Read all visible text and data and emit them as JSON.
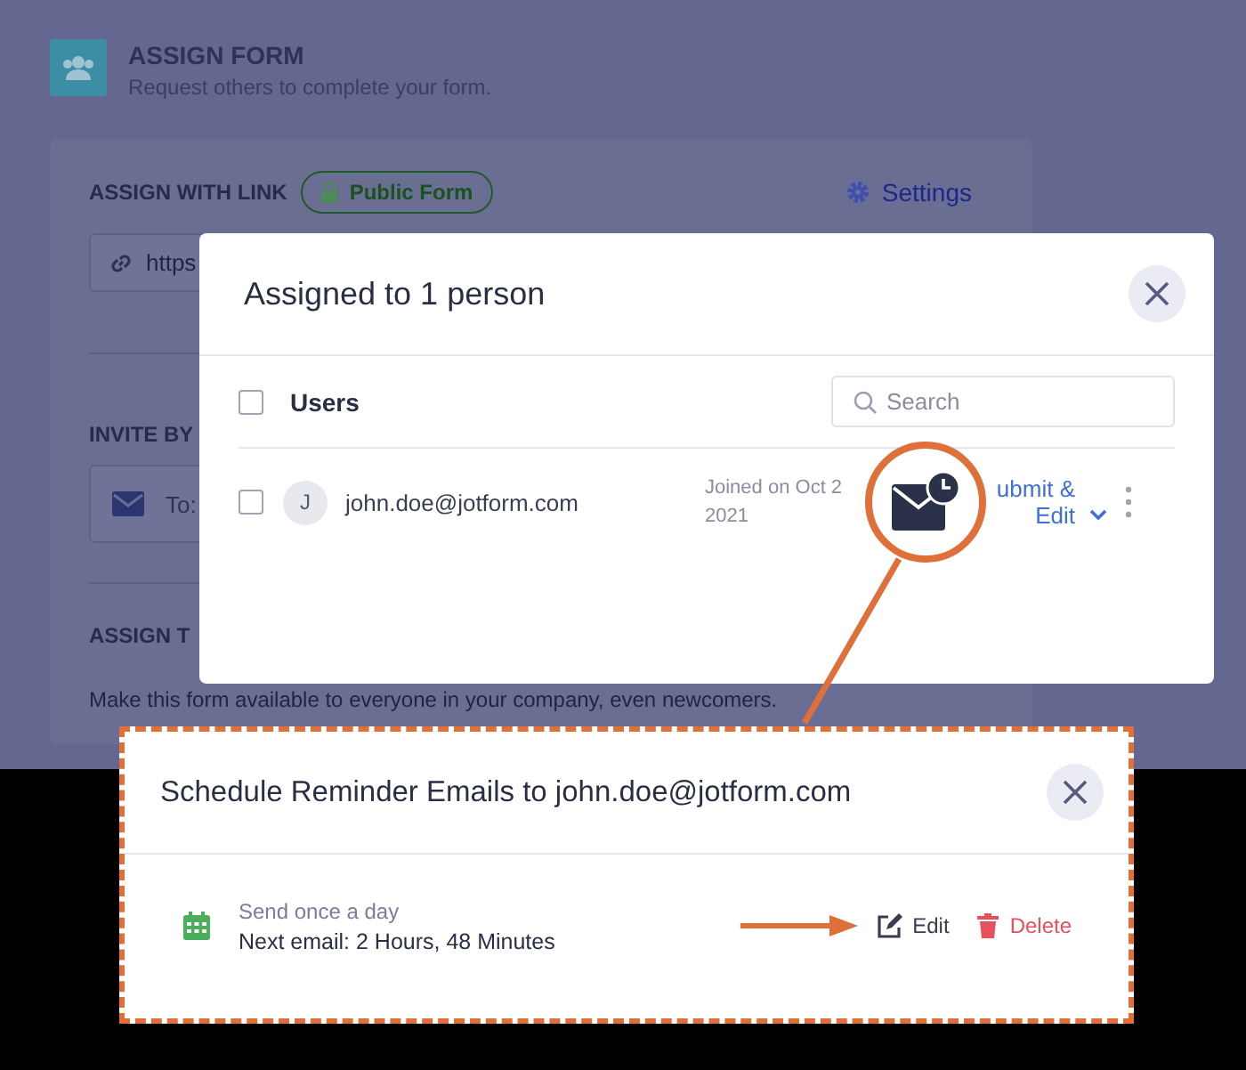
{
  "page": {
    "title": "ASSIGN FORM",
    "subtitle": "Request others to complete your form.",
    "link_section": {
      "heading": "ASSIGN WITH LINK",
      "badge": "Public Form",
      "settings": "Settings",
      "link_value": "https"
    },
    "invite_section": {
      "heading": "INVITE BY",
      "to_label": "To:"
    },
    "company_section": {
      "heading": "ASSIGN T",
      "description": "Make this form available to everyone in your company, even newcomers."
    }
  },
  "assign_dialog": {
    "title": "Assigned to 1 person",
    "select_all": {
      "label": "Users",
      "checked": false
    },
    "search": {
      "placeholder": "Search"
    },
    "users": [
      {
        "checked": false,
        "initial": "J",
        "email": "john.doe@jotform.com",
        "joined": "Joined on Oct 2",
        "joined_year": "2021",
        "action": "ubmit &",
        "action_2": "Edit"
      }
    ]
  },
  "reminder_dialog": {
    "title": "Schedule Reminder Emails to john.doe@jotform.com",
    "schedules": [
      {
        "frequency": "Send once a day",
        "next": "Next email: 2 Hours, 48 Minutes",
        "edit": "Edit",
        "delete": "Delete"
      }
    ]
  }
}
